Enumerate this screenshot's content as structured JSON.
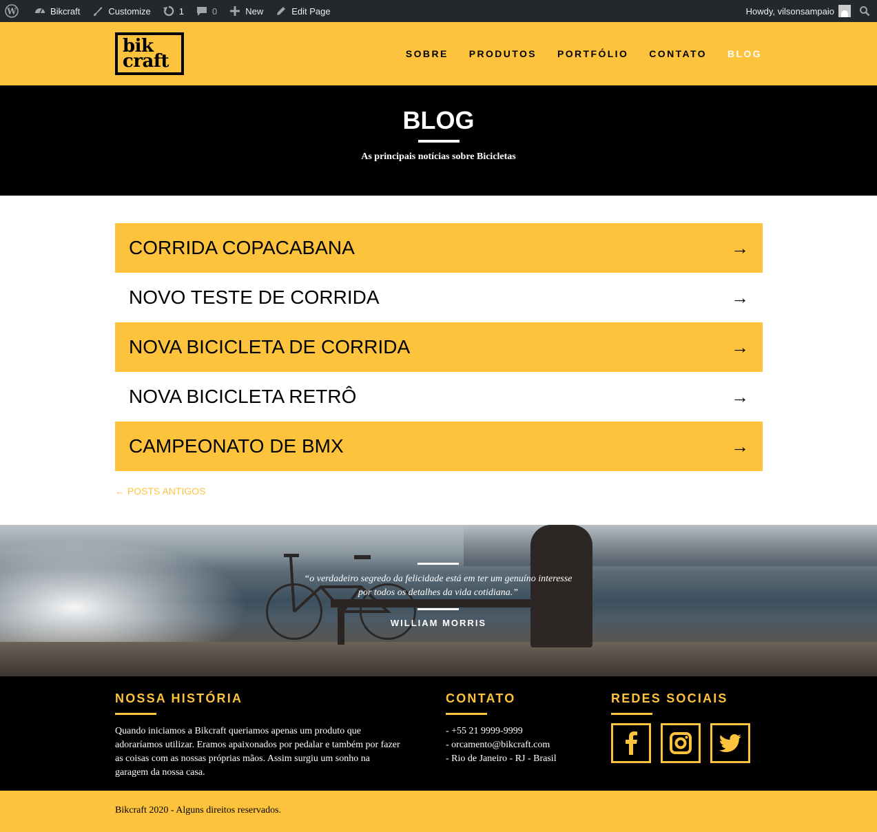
{
  "adminbar": {
    "site_name": "Bikcraft",
    "customize": "Customize",
    "updates_count": "1",
    "comments_count": "0",
    "new_label": "New",
    "edit_page": "Edit Page",
    "howdy": "Howdy, vilsonsampaio"
  },
  "header": {
    "logo_line1": "bik",
    "logo_line2": "craft",
    "nav": [
      "SOBRE",
      "PRODUTOS",
      "PORTFÓLIO",
      "CONTATO",
      "BLOG"
    ]
  },
  "hero": {
    "title": "BLOG",
    "subtitle": "As principais notícias sobre Bicicletas"
  },
  "posts": [
    {
      "title": "CORRIDA COPACABANA",
      "arrow": "→"
    },
    {
      "title": "NOVO TESTE DE CORRIDA",
      "arrow": "→"
    },
    {
      "title": "NOVA BICICLETA DE CORRIDA",
      "arrow": "→"
    },
    {
      "title": "NOVA BICICLETA RETRÔ",
      "arrow": "→"
    },
    {
      "title": "CAMPEONATO DE BMX",
      "arrow": "→"
    }
  ],
  "pagination": {
    "older": "← POSTS ANTIGOS"
  },
  "quote": {
    "text": "“o verdadeiro segredo da felicidade está em ter um genuíno interesse por todos os detalhes da vida cotidiana.”",
    "author": "WILLIAM MORRIS"
  },
  "footer": {
    "history": {
      "title": "NOSSA HISTÓRIA",
      "text": "Quando iniciamos a Bikcraft queriamos apenas um produto que adoraríamos utilizar. Eramos apaixonados por pedalar e também por fazer as coisas com as nossas próprias mãos. Assim surgiu um sonho na garagem da nossa casa."
    },
    "contact": {
      "title": "CONTATO",
      "items": [
        "- +55 21 9999-9999",
        "- orcamento@bikcraft.com",
        "- Rio de Janeiro - RJ - Brasil"
      ]
    },
    "social": {
      "title": "REDES SOCIAIS",
      "icons": [
        "facebook-icon",
        "instagram-icon",
        "twitter-icon"
      ]
    },
    "copyright": "Bikcraft 2020 - Alguns direitos reservados."
  },
  "colors": {
    "accent": "#fec33d",
    "dark": "#000000",
    "adminbar": "#23282d"
  }
}
